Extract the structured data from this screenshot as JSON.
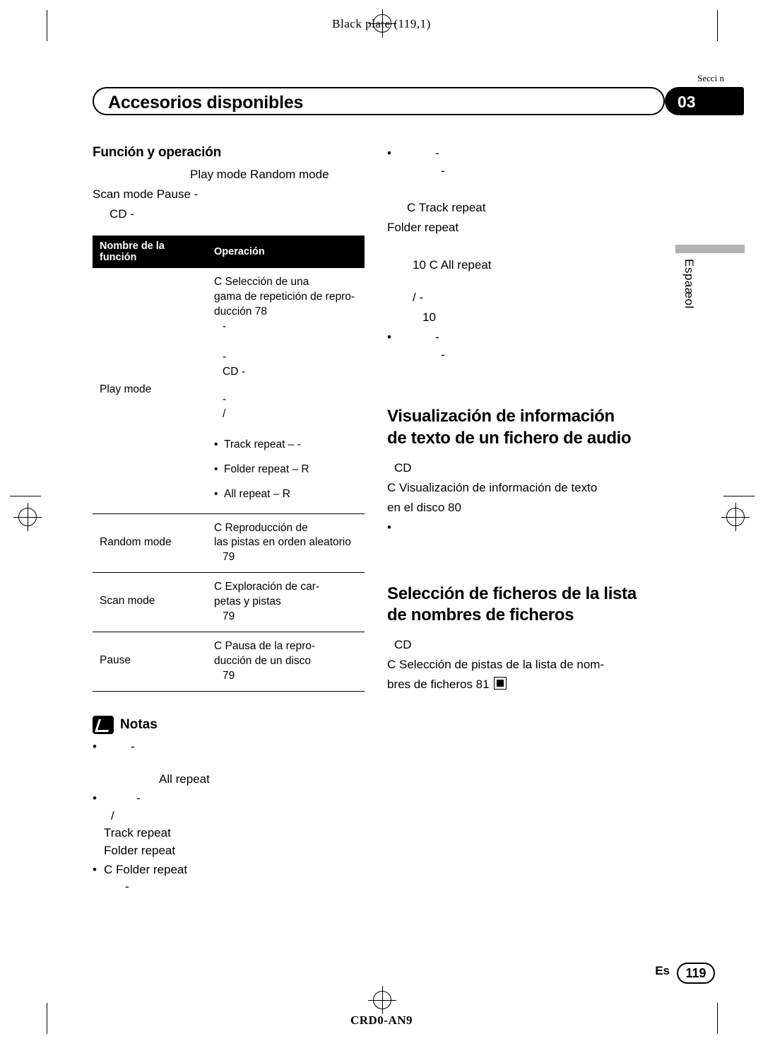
{
  "page": {
    "black_plate": "Black plate (119,1)",
    "section_label": "Secci n",
    "section_number": "03",
    "title": "Accesorios disponibles",
    "language_tab": "Espaæol",
    "footer_lang": "Es",
    "page_number": "119",
    "bottom_code": "CRD0-AN9"
  },
  "left": {
    "heading": "Función y operación",
    "intro_line1": "Play mode  Random mode",
    "intro_line2": "Scan mode   Pause      -",
    "intro_line3": "CD -",
    "table": {
      "headers": {
        "name": "Nombre de la función",
        "operation": "Operación"
      },
      "rows": [
        {
          "name": "Play mode",
          "op_lines": [
            "C          Selección de una",
            "gama de repetición de repro-",
            "ducción   78",
            "-",
            "",
            "-",
            "CD -",
            "",
            "-",
            "/"
          ],
          "bullets": [
            "Track repeat  –  -",
            "Folder repeat  – R",
            "All repeat  – R"
          ]
        },
        {
          "name": "Random mode",
          "op_lines": [
            "C          Reproducción de",
            "las pistas en orden aleatorio",
            "79"
          ],
          "bullets": []
        },
        {
          "name": "Scan mode",
          "op_lines": [
            "C          Exploración de car-",
            "petas y pistas",
            "79"
          ],
          "bullets": []
        },
        {
          "name": "Pause",
          "op_lines": [
            "C          Pausa de la repro-",
            "ducción de un disco",
            "79"
          ],
          "bullets": []
        }
      ]
    },
    "notes_title": "Notas",
    "notes": [
      {
        "lines": [
          "-",
          "",
          "All repeat"
        ]
      },
      {
        "lines": [
          "-",
          "/",
          "Track repeat",
          "Folder repeat"
        ]
      },
      {
        "lines": [
          "C                         Folder repeat",
          "-"
        ]
      }
    ]
  },
  "right": {
    "top_bullets": [
      {
        "lines": [
          "-",
          "-"
        ]
      }
    ],
    "para_block1": [
      "C                      Track repeat",
      "Folder repeat"
    ],
    "para_block2": [
      "10  C                                      All repeat"
    ],
    "para_block3": [
      "/  -",
      "10"
    ],
    "bullet_mid": {
      "lines": [
        "-",
        "-"
      ]
    },
    "heading1_line1": "Visualización de información",
    "heading1_line2": "de texto de un fichero de audio",
    "sec1_lines": [
      "CD",
      "C        Visualización de información de texto",
      "en el disco   80"
    ],
    "sec1_bullet": "",
    "heading2_line1": "Selección de ficheros de la lista",
    "heading2_line2": "de nombres de ficheros",
    "sec2_lines": [
      "CD",
      "C         Selección de pistas de la lista de nom-",
      "bres de ficheros   81"
    ]
  }
}
